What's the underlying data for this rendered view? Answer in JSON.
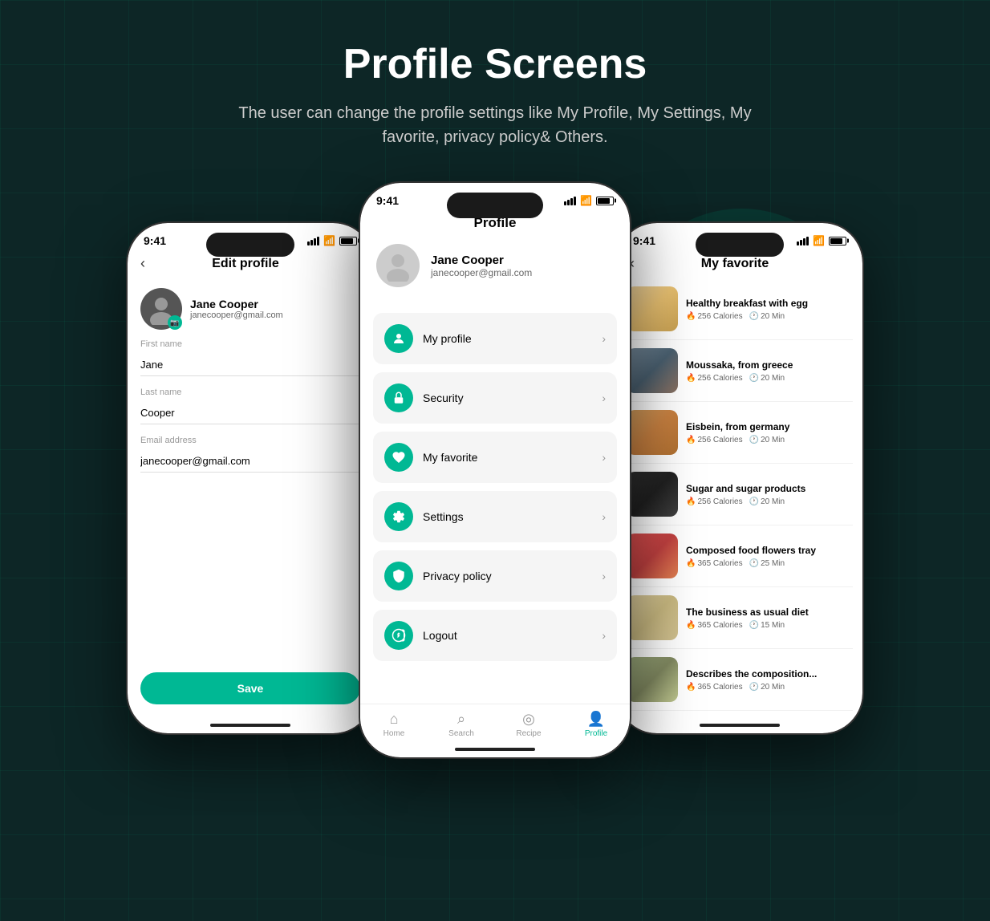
{
  "page": {
    "title": "Profile Screens",
    "subtitle": "The user can change the profile settings like My Profile,\nMy Settings, My favorite, privacy policy& Others."
  },
  "left_phone": {
    "status_time": "9:41",
    "screen_title": "Edit profile",
    "user_name": "Jane Cooper",
    "user_email": "janecooper@gmail.com",
    "fields": [
      {
        "label": "First name",
        "value": "Jane"
      },
      {
        "label": "Last name",
        "value": "Cooper"
      },
      {
        "label": "Email address",
        "value": "janecooper@gmail.com"
      }
    ],
    "save_btn": "Save"
  },
  "center_phone": {
    "status_time": "9:41",
    "screen_title": "Profile",
    "user_name": "Jane Cooper",
    "user_email": "janecooper@gmail.com",
    "menu_items": [
      {
        "id": "my-profile",
        "label": "My profile"
      },
      {
        "id": "security",
        "label": "Security"
      },
      {
        "id": "my-favorite",
        "label": "My favorite"
      },
      {
        "id": "settings",
        "label": "Settings"
      },
      {
        "id": "privacy-policy",
        "label": "Privacy policy"
      },
      {
        "id": "logout",
        "label": "Logout"
      }
    ],
    "nav_items": [
      {
        "id": "home",
        "label": "Home",
        "active": false
      },
      {
        "id": "search",
        "label": "Search",
        "active": false
      },
      {
        "id": "recipe",
        "label": "Recipe",
        "active": false
      },
      {
        "id": "profile",
        "label": "Profile",
        "active": true
      }
    ]
  },
  "right_phone": {
    "status_time": "9:41",
    "screen_title": "My favorite",
    "recipes": [
      {
        "name": "Healthy breakfast with egg",
        "calories": "256 Calories",
        "time": "20 Min",
        "thumb": "1"
      },
      {
        "name": "Moussaka, from greece",
        "calories": "256 Calories",
        "time": "20 Min",
        "thumb": "2"
      },
      {
        "name": "Eisbein, from germany",
        "calories": "256 Calories",
        "time": "20 Min",
        "thumb": "3"
      },
      {
        "name": "Sugar and sugar products",
        "calories": "256 Calories",
        "time": "20 Min",
        "thumb": "4"
      },
      {
        "name": "Composed food flowers tray",
        "calories": "365 Calories",
        "time": "25 Min",
        "thumb": "5"
      },
      {
        "name": "The business as usual diet",
        "calories": "365 Calories",
        "time": "15 Min",
        "thumb": "6"
      },
      {
        "name": "Describes the composition...",
        "calories": "365 Calories",
        "time": "20 Min",
        "thumb": "7"
      }
    ]
  },
  "colors": {
    "accent": "#00b894",
    "bg_dark": "#0d2626",
    "text_dark": "#000000",
    "text_gray": "#666666"
  }
}
